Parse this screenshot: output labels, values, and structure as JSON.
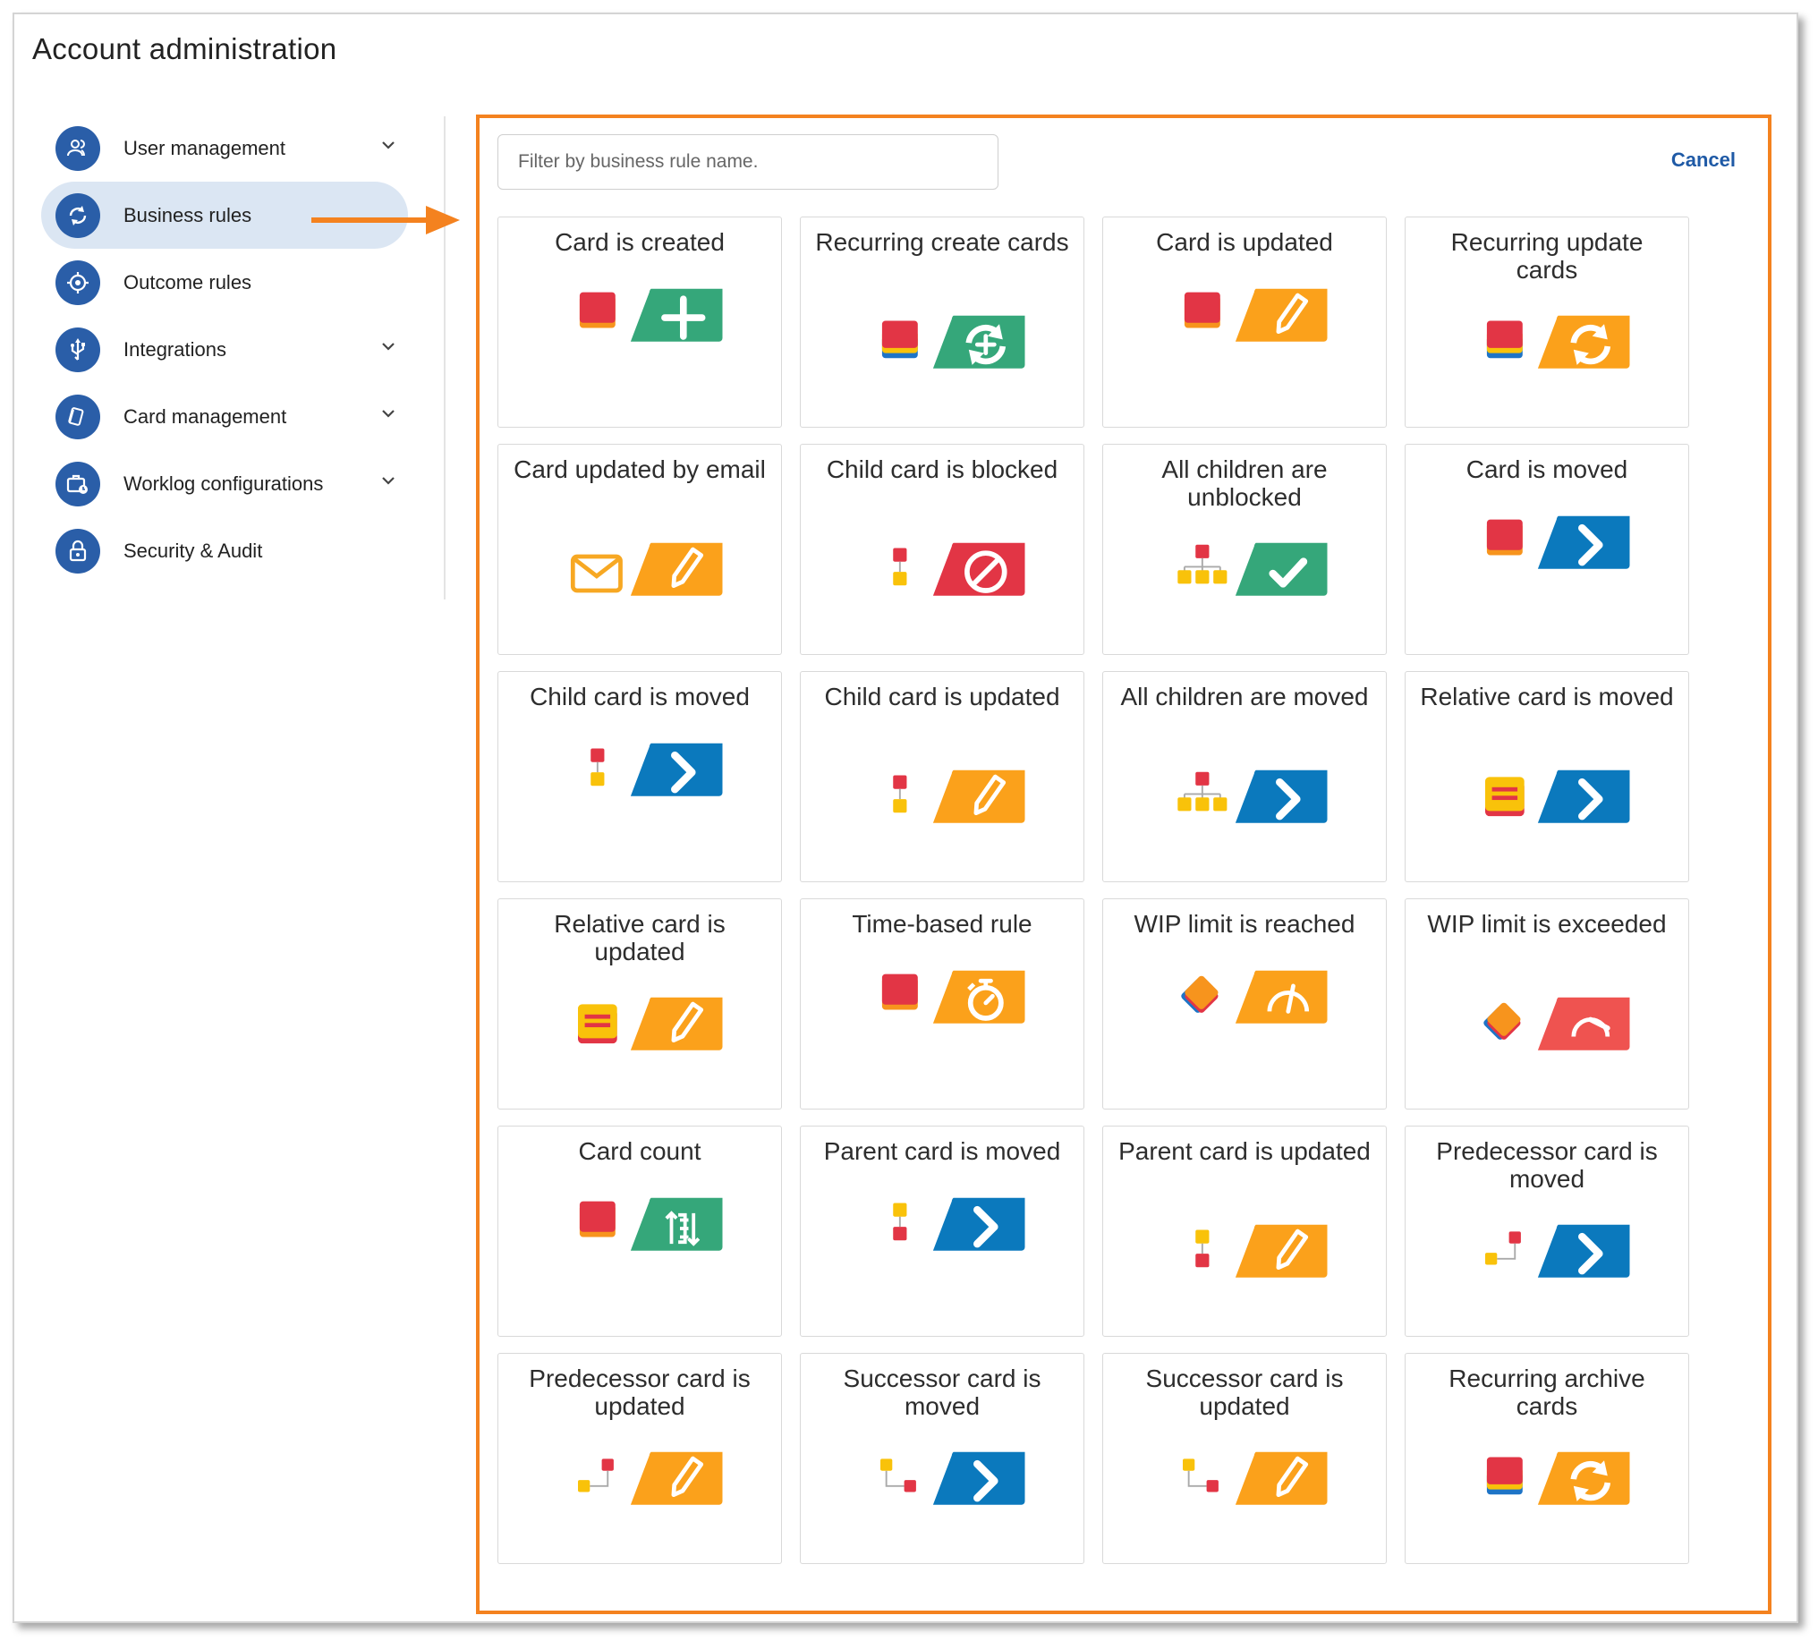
{
  "page_title": "Account administration",
  "sidebar": {
    "items": [
      {
        "label": "User management",
        "icon": "users-icon",
        "expandable": true,
        "active": false
      },
      {
        "label": "Business rules",
        "icon": "refresh-icon",
        "expandable": false,
        "active": true
      },
      {
        "label": "Outcome rules",
        "icon": "target-icon",
        "expandable": false,
        "active": false
      },
      {
        "label": "Integrations",
        "icon": "usb-icon",
        "expandable": true,
        "active": false
      },
      {
        "label": "Card management",
        "icon": "cards-icon",
        "expandable": true,
        "active": false
      },
      {
        "label": "Worklog configurations",
        "icon": "briefcase-clock-icon",
        "expandable": true,
        "active": false
      },
      {
        "label": "Security & Audit",
        "icon": "lock-icon",
        "expandable": false,
        "active": false
      }
    ]
  },
  "panel": {
    "filter_placeholder": "Filter by business rule name.",
    "filter_value": "",
    "cancel_label": "Cancel",
    "highlight_color": "#f4821f"
  },
  "colors": {
    "green": "#35a77a",
    "orange": "#fba11b",
    "blue": "#0b79bd",
    "red": "#e23545",
    "coral": "#ef5350",
    "yellow": "#f9c20a",
    "sidebar_icon": "#2a5ea8",
    "active_bg": "#dbe6f3",
    "link": "#1f5aa6"
  },
  "rules": [
    {
      "title": "Card is created",
      "trigger_icon": "single-card-icon",
      "action_icon": "plus-icon",
      "color": "green"
    },
    {
      "title": "Recurring create cards",
      "trigger_icon": "card-stack-icon",
      "action_icon": "recurring-create-icon",
      "color": "green"
    },
    {
      "title": "Card is updated",
      "trigger_icon": "single-card-icon",
      "action_icon": "pencil-icon",
      "color": "orange"
    },
    {
      "title": "Recurring update cards",
      "trigger_icon": "card-stack-icon",
      "action_icon": "recurring-icon",
      "color": "orange"
    },
    {
      "title": "Card updated by email",
      "trigger_icon": "envelope-icon",
      "action_icon": "pencil-icon",
      "color": "orange"
    },
    {
      "title": "Child card is blocked",
      "trigger_icon": "child-card-icon",
      "action_icon": "blocked-icon",
      "color": "red"
    },
    {
      "title": "All children are unblocked",
      "trigger_icon": "children-tree-icon",
      "action_icon": "check-icon",
      "color": "green"
    },
    {
      "title": "Card is moved",
      "trigger_icon": "single-card-icon",
      "action_icon": "chevron-right-icon",
      "color": "blue"
    },
    {
      "title": "Child card is moved",
      "trigger_icon": "child-card-icon",
      "action_icon": "chevron-right-icon",
      "color": "blue"
    },
    {
      "title": "Child card is updated",
      "trigger_icon": "child-card-icon",
      "action_icon": "pencil-icon",
      "color": "orange"
    },
    {
      "title": "All children are moved",
      "trigger_icon": "children-tree-icon",
      "action_icon": "chevron-right-icon",
      "color": "blue"
    },
    {
      "title": "Relative card is moved",
      "trigger_icon": "relative-card-icon",
      "action_icon": "chevron-right-icon",
      "color": "blue"
    },
    {
      "title": "Relative card is updated",
      "trigger_icon": "relative-card-icon",
      "action_icon": "pencil-icon",
      "color": "orange"
    },
    {
      "title": "Time-based rule",
      "trigger_icon": "single-card-icon",
      "action_icon": "stopwatch-icon",
      "color": "orange"
    },
    {
      "title": "WIP limit is reached",
      "trigger_icon": "lane-stack-icon",
      "action_icon": "gauge-icon",
      "color": "orange"
    },
    {
      "title": "WIP limit is exceeded",
      "trigger_icon": "lane-stack-icon",
      "action_icon": "gauge-exceeded-icon",
      "color": "coral"
    },
    {
      "title": "Card count",
      "trigger_icon": "single-card-icon",
      "action_icon": "count-icon",
      "color": "green"
    },
    {
      "title": "Parent card is moved",
      "trigger_icon": "parent-card-icon",
      "action_icon": "chevron-right-icon",
      "color": "blue"
    },
    {
      "title": "Parent card is updated",
      "trigger_icon": "parent-card-icon",
      "action_icon": "pencil-icon",
      "color": "orange"
    },
    {
      "title": "Predecessor card is moved",
      "trigger_icon": "predecessor-icon",
      "action_icon": "chevron-right-icon",
      "color": "blue"
    },
    {
      "title": "Predecessor card is updated",
      "trigger_icon": "predecessor-icon",
      "action_icon": "pencil-icon",
      "color": "orange"
    },
    {
      "title": "Successor card is moved",
      "trigger_icon": "successor-icon",
      "action_icon": "chevron-right-icon",
      "color": "blue"
    },
    {
      "title": "Successor card is updated",
      "trigger_icon": "successor-icon",
      "action_icon": "pencil-icon",
      "color": "orange"
    },
    {
      "title": "Recurring archive cards",
      "trigger_icon": "card-stack-icon",
      "action_icon": "recurring-icon",
      "color": "orange"
    }
  ]
}
